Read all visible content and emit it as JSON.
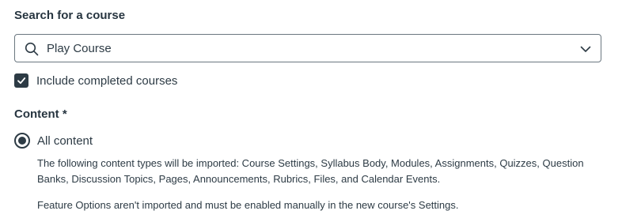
{
  "search": {
    "label": "Search for a course",
    "value": "Play Course",
    "icon": "search-icon",
    "dropdown_icon": "chevron-down-icon"
  },
  "include_completed": {
    "label": "Include completed courses",
    "checked": true
  },
  "content": {
    "label": "Content *",
    "options": [
      {
        "label": "All content",
        "selected": true
      }
    ],
    "description": "The following content types will be imported: Course Settings, Syllabus Body, Modules, Assignments, Quizzes, Question Banks, Discussion Topics, Pages, Announcements, Rubrics, Files, and Calendar Events.",
    "note": "Feature Options aren't imported and must be enabled manually in the new course's Settings."
  },
  "colors": {
    "text": "#2d3b45",
    "border": "#6b7780",
    "background": "#ffffff"
  }
}
